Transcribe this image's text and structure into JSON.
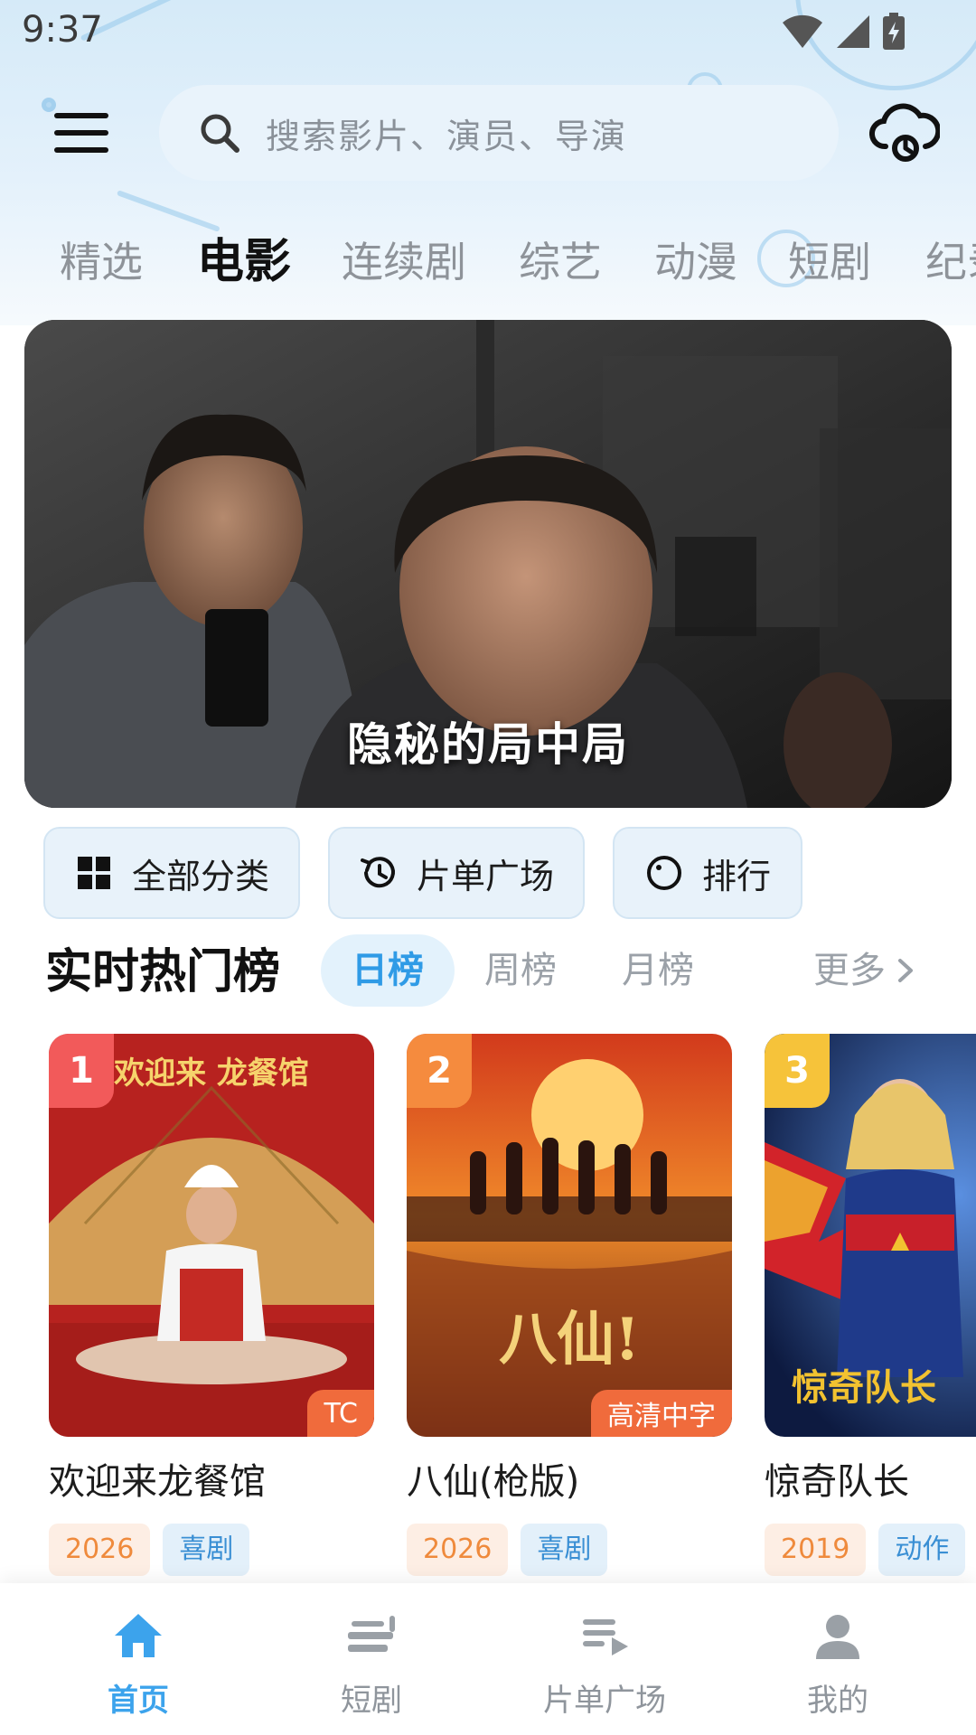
{
  "status_bar": {
    "time": "9:37"
  },
  "search": {
    "placeholder": "搜索影片、演员、导演"
  },
  "category_tabs": [
    {
      "label": "精选"
    },
    {
      "label": "电影",
      "active": true
    },
    {
      "label": "连续剧"
    },
    {
      "label": "综艺"
    },
    {
      "label": "动漫"
    },
    {
      "label": "短剧"
    },
    {
      "label": "纪录片"
    }
  ],
  "banner": {
    "title": "隐秘的局中局"
  },
  "quick_actions": [
    {
      "label": "全部分类",
      "icon": "grid-icon"
    },
    {
      "label": "片单广场",
      "icon": "history-icon"
    },
    {
      "label": "排行",
      "icon": "clock-icon"
    }
  ],
  "hot_rank": {
    "title": "实时热门榜",
    "tabs": [
      {
        "label": "日榜",
        "active": true
      },
      {
        "label": "周榜"
      },
      {
        "label": "月榜"
      }
    ],
    "more_label": "更多"
  },
  "movies": [
    {
      "rank": "1",
      "title": "欢迎来龙餐馆",
      "year": "2026",
      "genre": "喜剧",
      "quality": "TC",
      "rank_color": "#f25a5a",
      "quality_color": "#f06b3c",
      "poster_text": "欢迎来 龙餐馆"
    },
    {
      "rank": "2",
      "title": "八仙(枪版)",
      "year": "2026",
      "genre": "喜剧",
      "quality": "高清中字",
      "rank_color": "#f58b3e",
      "quality_color": "#f06b3c",
      "poster_text": "八仙!"
    },
    {
      "rank": "3",
      "title": "惊奇队长",
      "year": "2019",
      "genre": "动作",
      "quality": "",
      "rank_color": "#f6c33a",
      "quality_color": "#f06b3c",
      "poster_text": "惊奇队长"
    }
  ],
  "bottom_nav": [
    {
      "label": "首页",
      "icon": "home-icon",
      "active": true
    },
    {
      "label": "短剧",
      "icon": "short-drama-icon"
    },
    {
      "label": "片单广场",
      "icon": "playlist-icon"
    },
    {
      "label": "我的",
      "icon": "profile-icon"
    }
  ],
  "colors": {
    "accent": "#3ca3ec",
    "tab_active_bg": "#e3f2fc"
  }
}
